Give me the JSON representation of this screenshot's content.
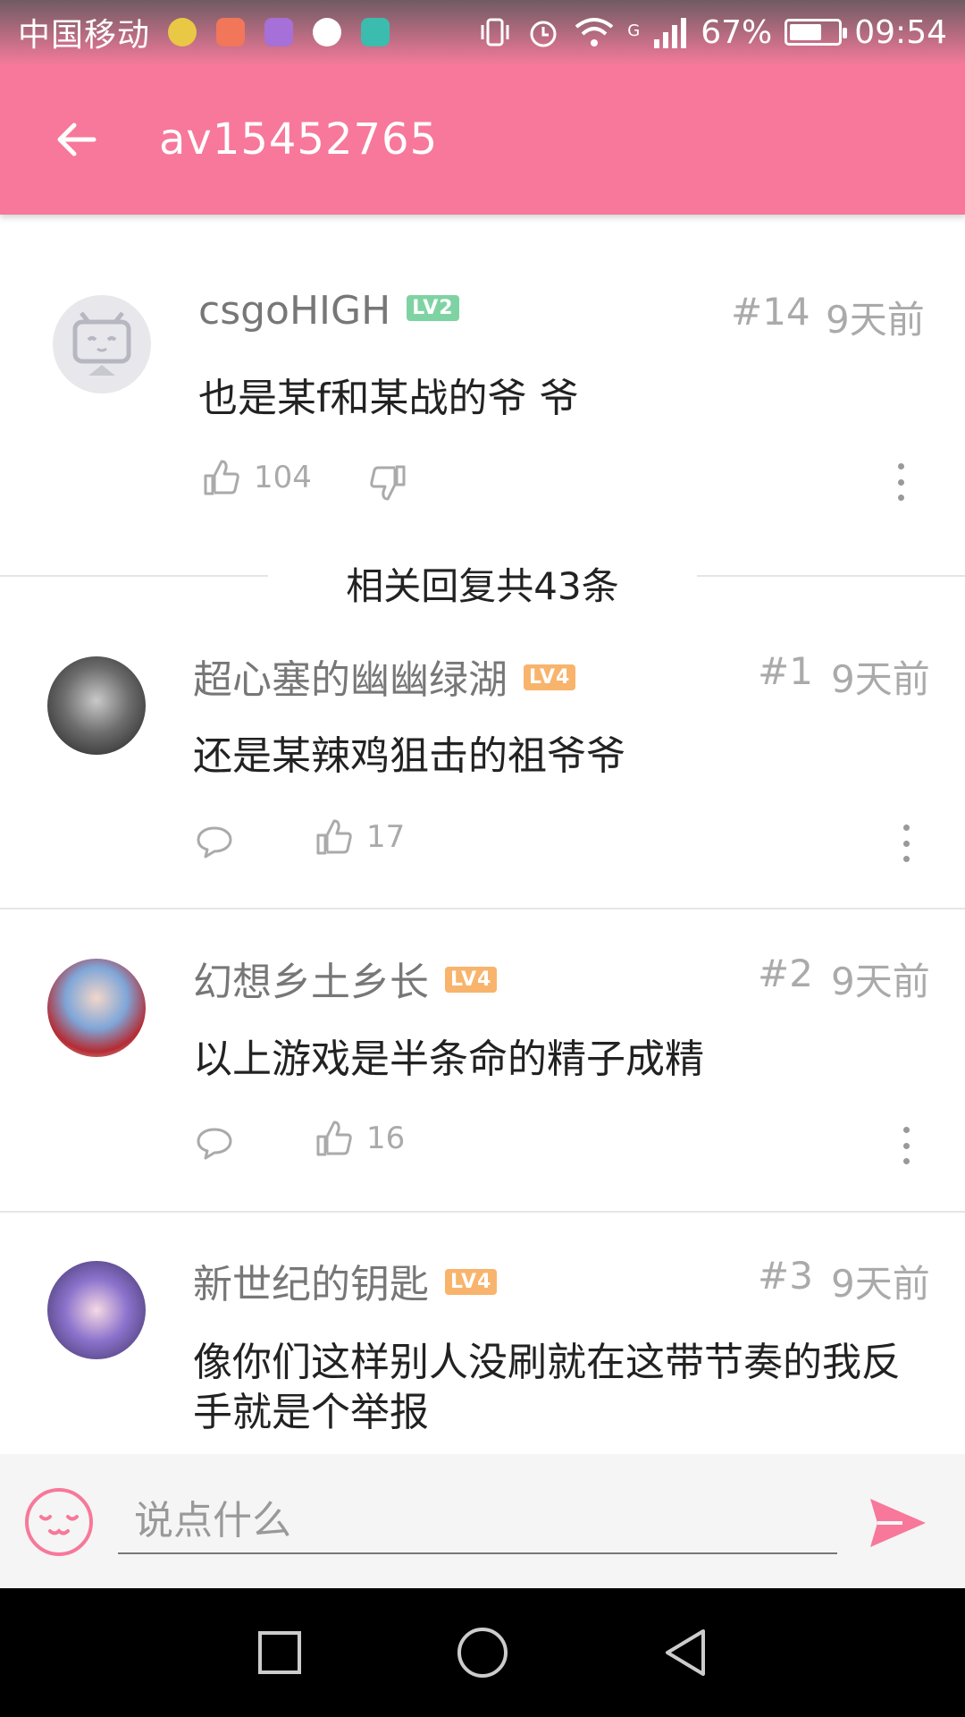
{
  "status_bar": {
    "carrier": "中国移动",
    "network": "G",
    "battery": "67%",
    "battery_level": 0.67,
    "time": "09:54"
  },
  "app_bar": {
    "title": "av15452765",
    "back_icon": "arrow-left-icon"
  },
  "main_comment": {
    "username": "csgoHIGH",
    "level": "LV2",
    "floor": "#14",
    "time": "9天前",
    "text": "也是某f和某战的爷 爷",
    "likes": "104"
  },
  "related_label": "相关回复共43条",
  "replies": [
    {
      "username": "超心塞的幽幽绿湖",
      "level": "LV4",
      "floor": "#1",
      "time": "9天前",
      "text": "还是某辣鸡狙击的祖爷爷",
      "likes": "17"
    },
    {
      "username": "幻想乡土乡长",
      "level": "LV4",
      "floor": "#2",
      "time": "9天前",
      "text": "以上游戏是半条命的精子成精",
      "likes": "16"
    },
    {
      "username": "新世纪的钥匙",
      "level": "LV4",
      "floor": "#3",
      "time": "9天前",
      "text": "像你们这样别人没刷就在这带节奏的我反手就是个举报",
      "likes": ""
    }
  ],
  "input_bar": {
    "placeholder": "说点什么"
  },
  "colors": {
    "accent": "#f7789a",
    "lv2": "#7fd3a3",
    "lv4": "#f8b46c"
  }
}
